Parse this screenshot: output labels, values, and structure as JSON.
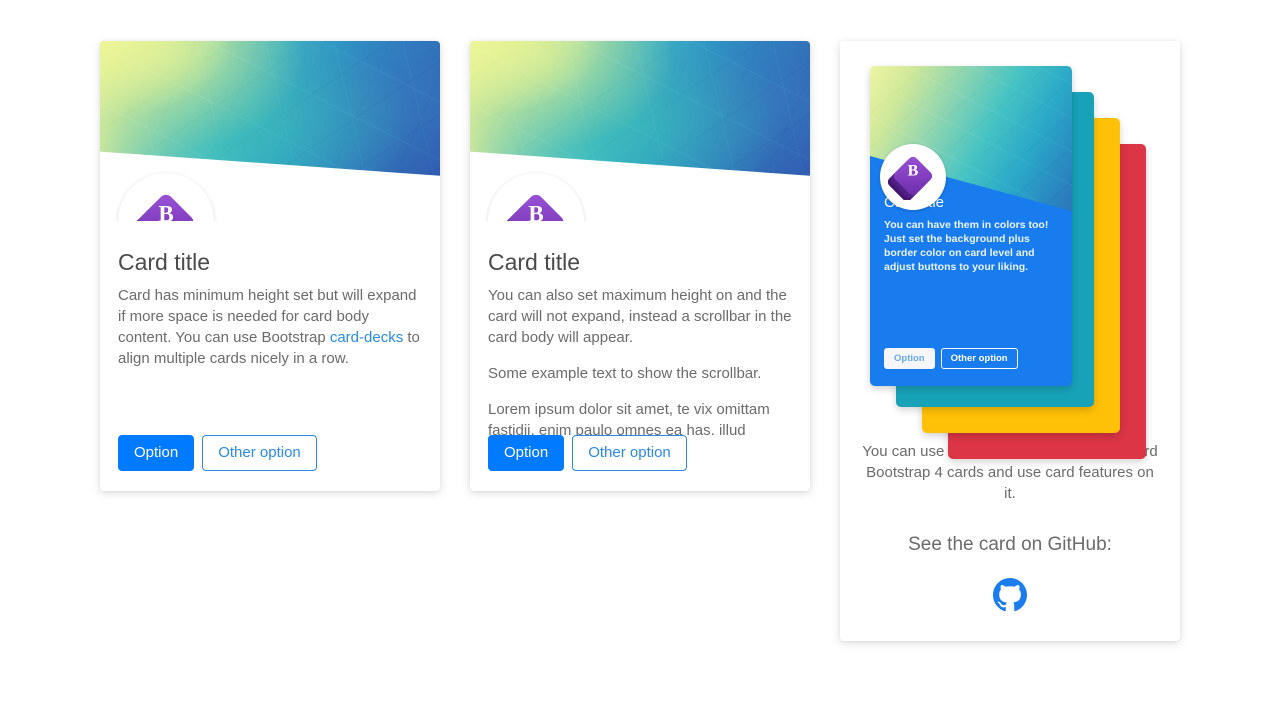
{
  "page": {
    "background_color": "#ffffff",
    "accent_color": "#007bff",
    "link_color": "#2a8ae4",
    "muted_text_color": "#6b6b6b"
  },
  "cards": [
    {
      "id": "card-min-height",
      "title": "Card title",
      "text_before_link": "Card has minimum height set but will expand if more space is needed for card body content. You can use Bootstrap ",
      "link_label": "card-decks",
      "text_after_link": " to align multiple cards nicely in a row.",
      "avatar_icon": "bootstrap-logo-icon",
      "buttons": {
        "primary_label": "Option",
        "secondary_label": "Other option"
      }
    },
    {
      "id": "card-max-height",
      "title": "Card title",
      "paragraphs": [
        "You can also set maximum height on and the card will not expand, instead a scrollbar in the card body will appear.",
        "Some example text to show the scrollbar.",
        "Lorem ipsum dolor sit amet, te vix omittam fastidii, enim paulo omnes ea has, illud"
      ],
      "avatar_icon": "bootstrap-logo-icon",
      "buttons": {
        "primary_label": "Option",
        "secondary_label": "Other option"
      }
    },
    {
      "id": "card-showcase",
      "stack_preview": {
        "title": "Card title",
        "text": "You can have them in colors too! Just set the background plus border color on card level and adjust buttons to your liking.",
        "primary_label": "Option",
        "secondary_label": "Other option",
        "layer_colors": [
          "#187bee",
          "#17a2b8",
          "#ffc107",
          "#dc3545"
        ]
      },
      "text": "You can use this card together with standard Bootstrap 4 cards and use card features on it.",
      "subtitle": "See the card on GitHub:",
      "github_icon": "github-icon",
      "github_icon_color": "#1b7ced"
    }
  ]
}
